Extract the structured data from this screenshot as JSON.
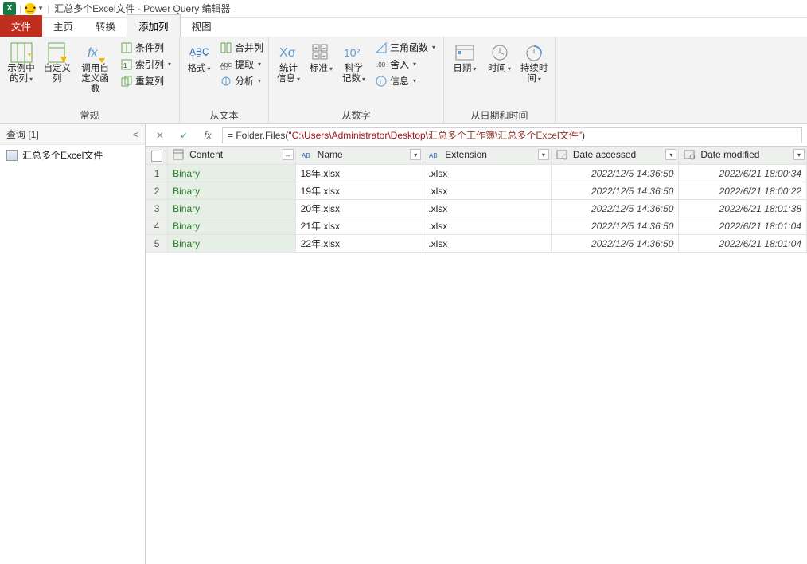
{
  "window": {
    "app_icon_text": "X",
    "title": "汇总多个Excel文件 - Power Query 编辑器"
  },
  "tabs": {
    "file": "文件",
    "home": "主页",
    "transform": "转换",
    "add_column": "添加列",
    "view": "视图"
  },
  "ribbon": {
    "group1_label": "常规",
    "group2_label": "从文本",
    "group3_label": "从数字",
    "group4_label": "从日期和时间",
    "examples": "示例中的列",
    "custom_col": "自定义列",
    "invoke_fn": "调用自定义函数",
    "cond_col": "条件列",
    "index_col": "索引列",
    "dup_col": "重复列",
    "format": "格式",
    "merge_cols": "合并列",
    "extract": "提取",
    "parse": "分析",
    "stats": "统计信息",
    "standard": "标准",
    "scientific": "科学记数",
    "trig": "三角函数",
    "rounding": "舍入",
    "info": "信息",
    "date": "日期",
    "time": "时间",
    "duration": "持续时间"
  },
  "sidebar": {
    "header": "查询 [1]",
    "collapse": "<",
    "item": "汇总多个Excel文件"
  },
  "formula_bar": {
    "prefix": "= Folder.Files(",
    "str_open": "\"",
    "path_plain": "C:\\Users\\Administrator\\Desktop\\",
    "path_cn": "汇总多个工作簿\\汇总多个Excel文件",
    "str_close": "\"",
    "suffix": ")"
  },
  "columns": {
    "content": "Content",
    "name": "Name",
    "extension": "Extension",
    "date_accessed": "Date accessed",
    "date_modified": "Date modified"
  },
  "rows": [
    {
      "n": "1",
      "content": "Binary",
      "name": "18年.xlsx",
      "ext": ".xlsx",
      "accessed": "2022/12/5 14:36:50",
      "modified": "2022/6/21 18:00:34"
    },
    {
      "n": "2",
      "content": "Binary",
      "name": "19年.xlsx",
      "ext": ".xlsx",
      "accessed": "2022/12/5 14:36:50",
      "modified": "2022/6/21 18:00:22"
    },
    {
      "n": "3",
      "content": "Binary",
      "name": "20年.xlsx",
      "ext": ".xlsx",
      "accessed": "2022/12/5 14:36:50",
      "modified": "2022/6/21 18:01:38"
    },
    {
      "n": "4",
      "content": "Binary",
      "name": "21年.xlsx",
      "ext": ".xlsx",
      "accessed": "2022/12/5 14:36:50",
      "modified": "2022/6/21 18:01:04"
    },
    {
      "n": "5",
      "content": "Binary",
      "name": "22年.xlsx",
      "ext": ".xlsx",
      "accessed": "2022/12/5 14:36:50",
      "modified": "2022/6/21 18:01:04"
    }
  ]
}
